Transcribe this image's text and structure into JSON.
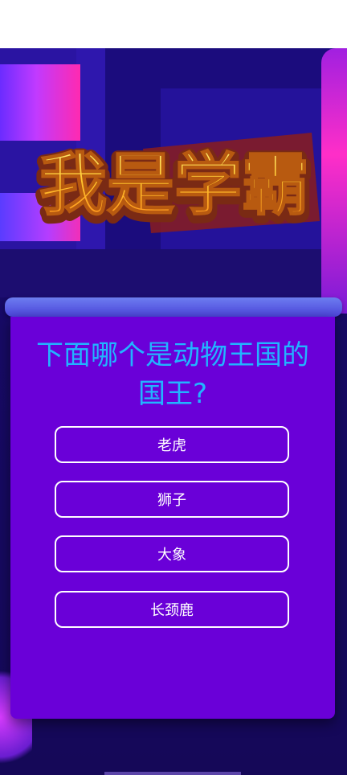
{
  "title": {
    "text": "我是学霸"
  },
  "question": {
    "text": "下面哪个是动物王国的国王?"
  },
  "options": [
    {
      "label": "老虎"
    },
    {
      "label": "狮子"
    },
    {
      "label": "大象"
    },
    {
      "label": "长颈鹿"
    }
  ],
  "colors": {
    "card": "#6a00d8",
    "question_text": "#22b4ff",
    "option_border": "#ffffff",
    "background": "#1a0a78",
    "title_fill": "#ffc52e",
    "title_outline": "#7a2a14"
  }
}
